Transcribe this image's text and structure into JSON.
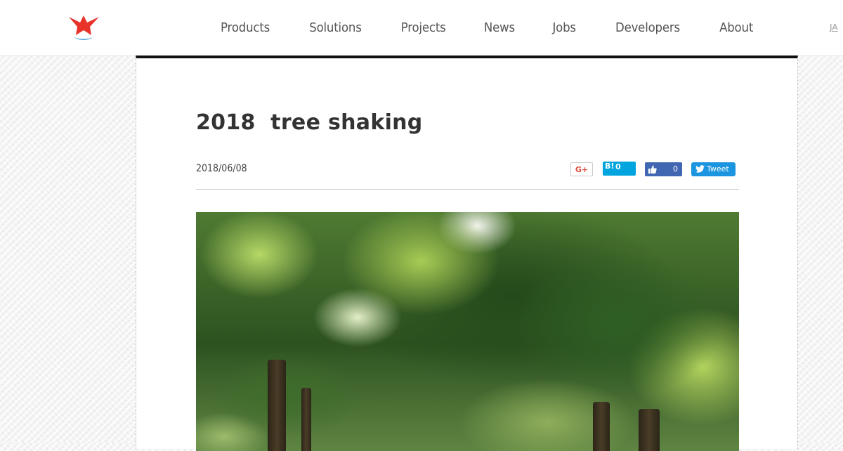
{
  "header": {
    "nav": [
      "Products",
      "Solutions",
      "Projects",
      "News",
      "Jobs",
      "Developers",
      "About"
    ],
    "lang_link": "JA"
  },
  "article": {
    "title": "2018  tree shaking",
    "date": "2018/06/08",
    "image_alt": "Photo of green leafy trees in a park"
  },
  "share": {
    "gplus_label": "G+",
    "hatena_logo": "B!",
    "hatena_count": "0",
    "like_count": "0",
    "tweet_label": "Tweet"
  },
  "colors": {
    "logo_red": "#e8332a",
    "logo_blue": "#3aa0d8",
    "accent_bar": "#111111",
    "hatena_blue": "#00a4de",
    "facebook_blue": "#4267b2",
    "twitter_blue": "#1b95e0",
    "gplus_red": "#dd4b39"
  },
  "icons": {
    "logo": "red-star-swoosh-logo",
    "like": "thumbs-up-icon",
    "tweet": "twitter-bird-icon"
  }
}
